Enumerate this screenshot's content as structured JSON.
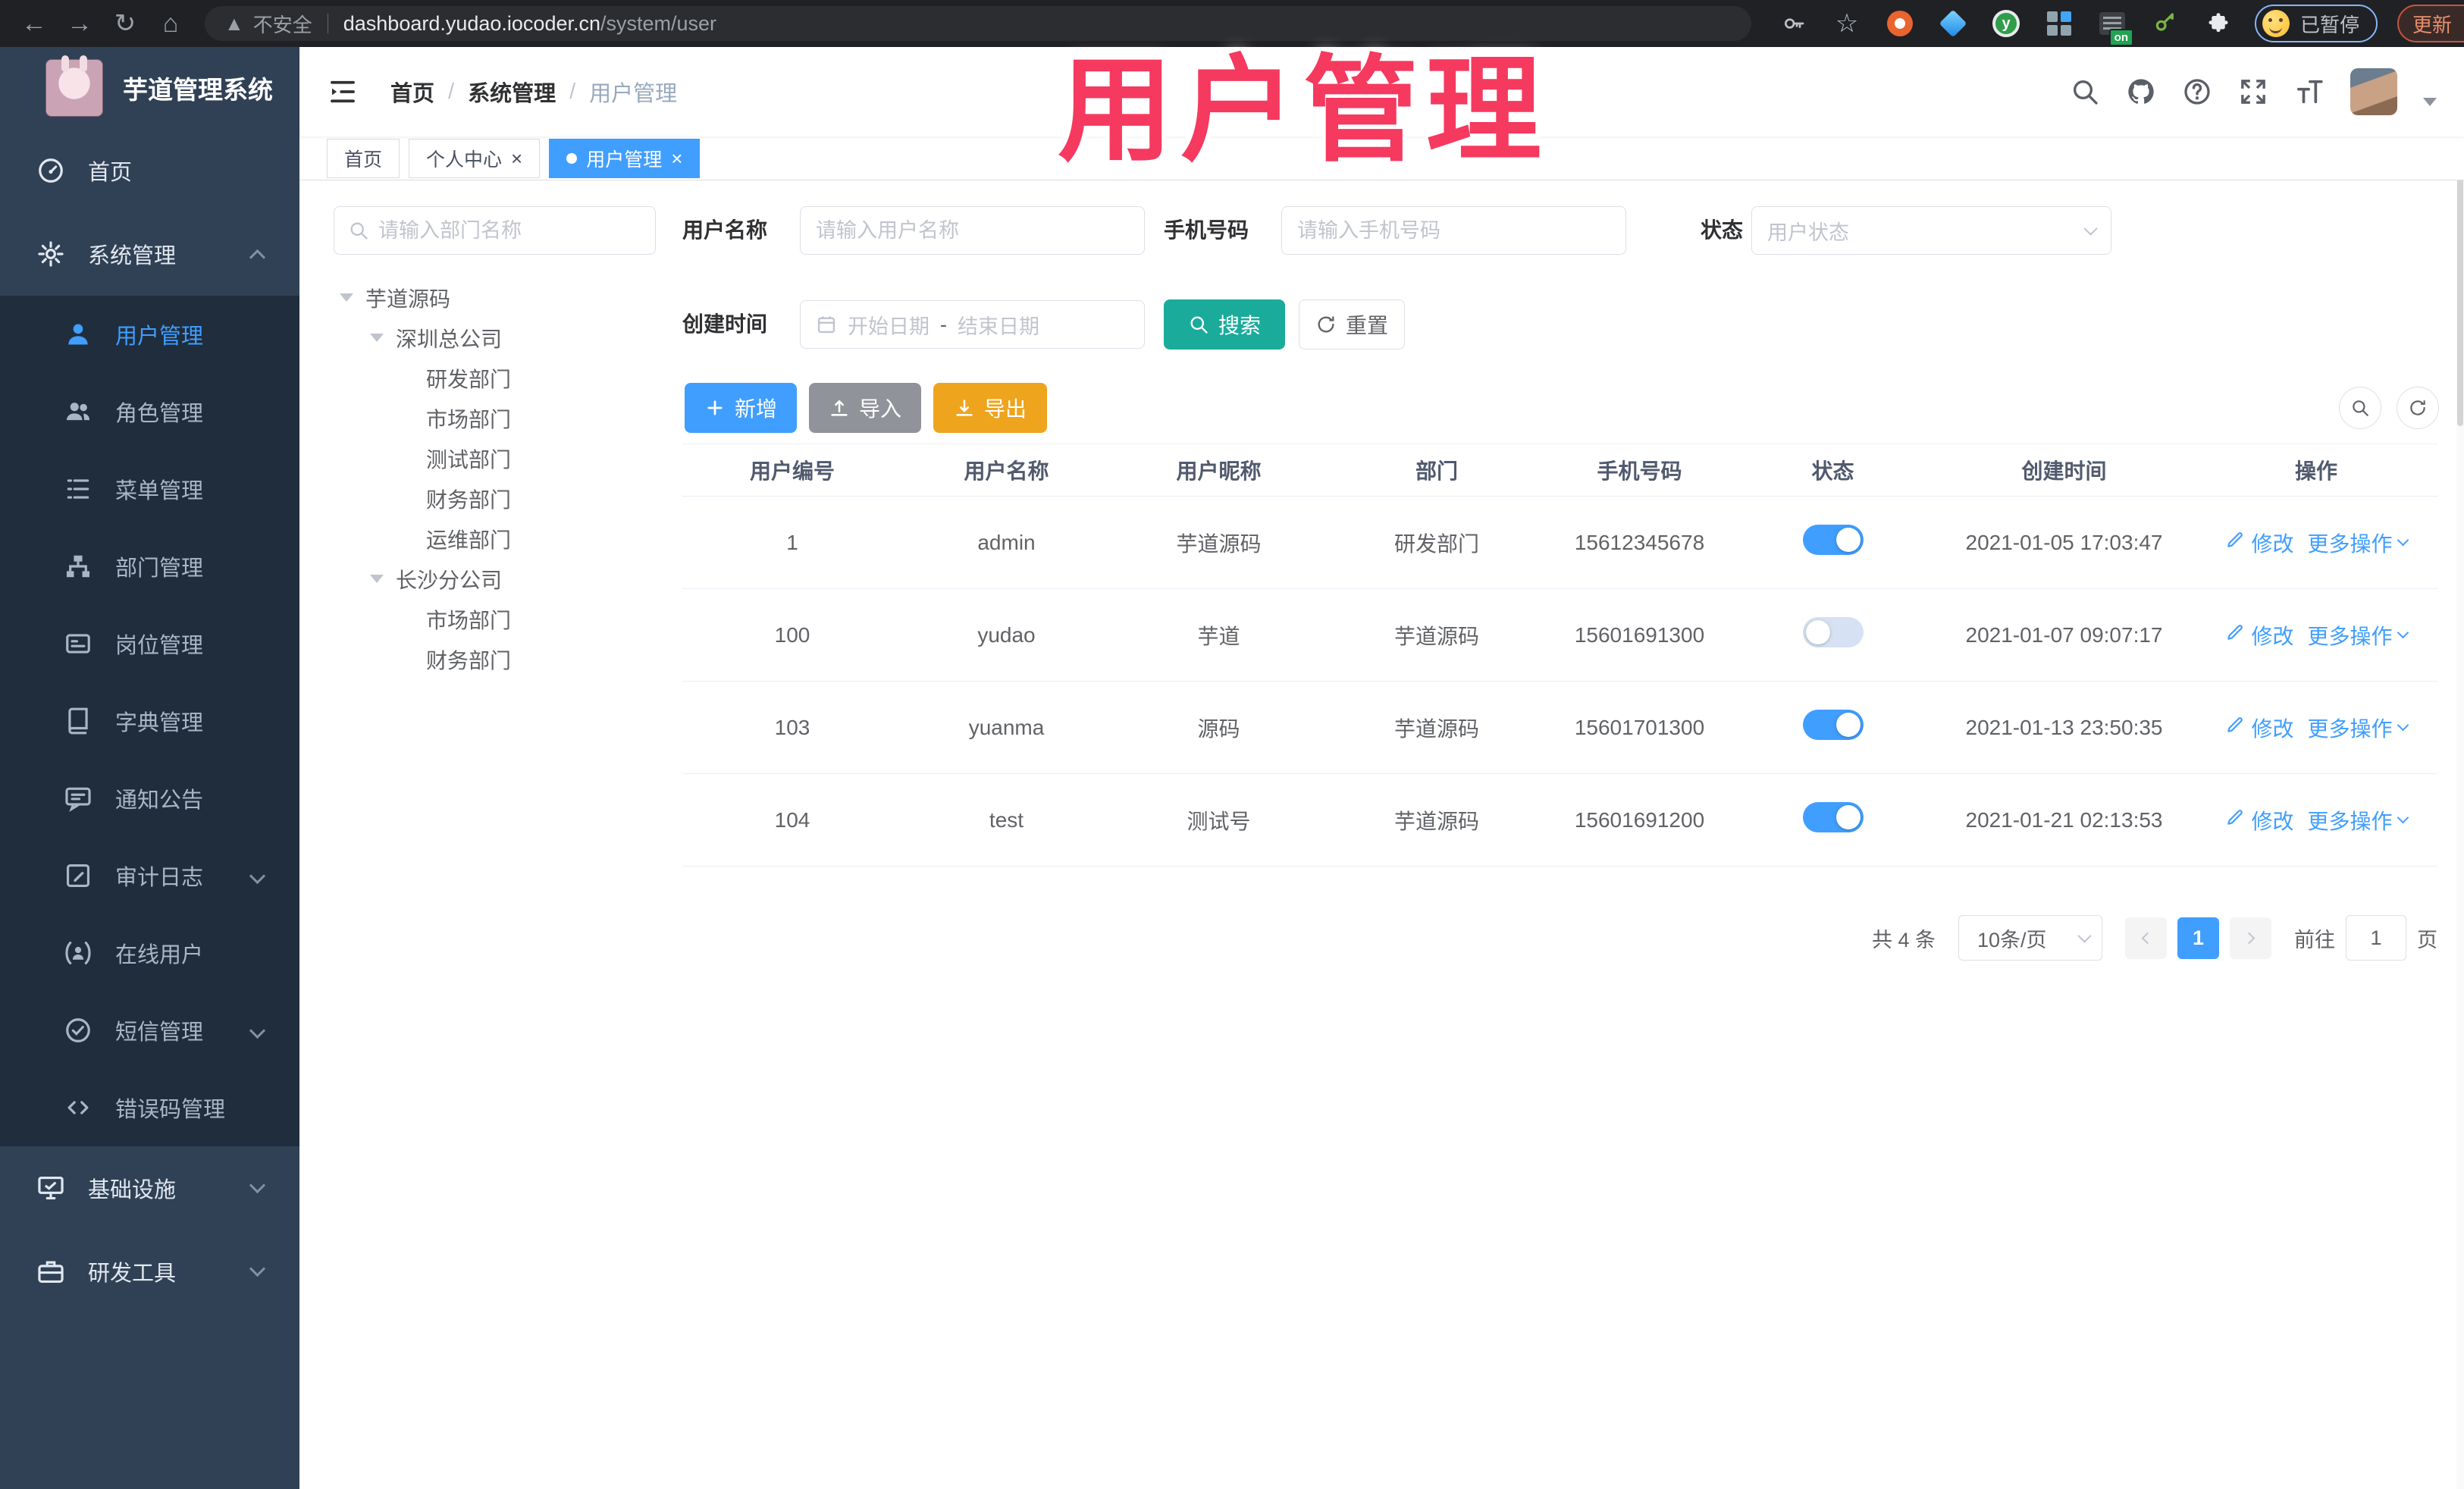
{
  "browser": {
    "security_label": "不安全",
    "url_host": "dashboard.yudao.iocoder.cn",
    "url_path": "/system/user",
    "profile_status": "已暂停",
    "update_label": "更新"
  },
  "icons": {
    "close": "×",
    "extension_on_badge": "on",
    "extension_y_logo": "y"
  },
  "watermark": {
    "text": "用户管理",
    "color": "#f5395f"
  },
  "sidebar": {
    "title": "芋道管理系统",
    "items": [
      {
        "key": "home",
        "icon": "gauge",
        "label": "首页",
        "type": "top"
      },
      {
        "key": "system",
        "icon": "gear",
        "label": "系统管理",
        "type": "top",
        "chevron": "up"
      },
      {
        "key": "user-mgmt",
        "icon": "user",
        "label": "用户管理",
        "type": "sub",
        "active": true
      },
      {
        "key": "role-mgmt",
        "icon": "users",
        "label": "角色管理",
        "type": "sub"
      },
      {
        "key": "menu-mgmt",
        "icon": "menu",
        "label": "菜单管理",
        "type": "sub"
      },
      {
        "key": "dept-mgmt",
        "icon": "dept",
        "label": "部门管理",
        "type": "sub"
      },
      {
        "key": "post-mgmt",
        "icon": "post",
        "label": "岗位管理",
        "type": "sub"
      },
      {
        "key": "dict-mgmt",
        "icon": "dict",
        "label": "字典管理",
        "type": "sub"
      },
      {
        "key": "notice",
        "icon": "notice",
        "label": "通知公告",
        "type": "sub"
      },
      {
        "key": "audit-log",
        "icon": "audit",
        "label": "审计日志",
        "type": "sub",
        "chevron": "down"
      },
      {
        "key": "online-users",
        "icon": "online",
        "label": "在线用户",
        "type": "sub"
      },
      {
        "key": "sms-mgmt",
        "icon": "sms",
        "label": "短信管理",
        "type": "sub",
        "chevron": "down"
      },
      {
        "key": "error-code",
        "icon": "errcode",
        "label": "错误码管理",
        "type": "sub"
      },
      {
        "key": "infra",
        "icon": "infra",
        "label": "基础设施",
        "type": "top",
        "chevron": "down"
      },
      {
        "key": "dev-tools",
        "icon": "tools",
        "label": "研发工具",
        "type": "top",
        "chevron": "down"
      }
    ]
  },
  "breadcrumb": {
    "separator": "/",
    "items": [
      "首页",
      "系统管理",
      "用户管理"
    ]
  },
  "tabs": [
    {
      "key": "home",
      "label": "首页"
    },
    {
      "key": "profile",
      "label": "个人中心",
      "closable": true
    },
    {
      "key": "user-mgmt",
      "label": "用户管理",
      "closable": true,
      "active": true
    }
  ],
  "dept_tree": {
    "search_placeholder": "请输入部门名称",
    "nodes": [
      {
        "label": "芋道源码",
        "indent": 0,
        "expandable": true
      },
      {
        "label": "深圳总公司",
        "indent": 1,
        "expandable": true
      },
      {
        "label": "研发部门",
        "indent": 2
      },
      {
        "label": "市场部门",
        "indent": 2
      },
      {
        "label": "测试部门",
        "indent": 2
      },
      {
        "label": "财务部门",
        "indent": 2
      },
      {
        "label": "运维部门",
        "indent": 2
      },
      {
        "label": "长沙分公司",
        "indent": 1,
        "expandable": true
      },
      {
        "label": "市场部门",
        "indent": 2
      },
      {
        "label": "财务部门",
        "indent": 2
      }
    ]
  },
  "filters": {
    "username_label": "用户名称",
    "username_placeholder": "请输入用户名称",
    "mobile_label": "手机号码",
    "mobile_placeholder": "请输入手机号码",
    "status_label": "状态",
    "status_placeholder": "用户状态",
    "create_time_label": "创建时间",
    "date_start_placeholder": "开始日期",
    "date_separator": "-",
    "date_end_placeholder": "结束日期",
    "search_label": "搜索",
    "reset_label": "重置"
  },
  "toolbar": {
    "add_label": "新增",
    "import_label": "导入",
    "export_label": "导出"
  },
  "table": {
    "columns": [
      "用户编号",
      "用户名称",
      "用户昵称",
      "部门",
      "手机号码",
      "状态",
      "创建时间",
      "操作"
    ],
    "row_actions": {
      "edit": "修改",
      "more": "更多操作"
    },
    "rows": [
      {
        "id": "1",
        "username": "admin",
        "nickname": "芋道源码",
        "dept": "研发部门",
        "mobile": "15612345678",
        "status": true,
        "created": "2021-01-05 17:03:47"
      },
      {
        "id": "100",
        "username": "yudao",
        "nickname": "芋道",
        "dept": "芋道源码",
        "mobile": "15601691300",
        "status": false,
        "created": "2021-01-07 09:07:17"
      },
      {
        "id": "103",
        "username": "yuanma",
        "nickname": "源码",
        "dept": "芋道源码",
        "mobile": "15601701300",
        "status": true,
        "created": "2021-01-13 23:50:35"
      },
      {
        "id": "104",
        "username": "test",
        "nickname": "测试号",
        "dept": "芋道源码",
        "mobile": "15601691200",
        "status": true,
        "created": "2021-01-21 02:13:53"
      }
    ]
  },
  "pagination": {
    "total_label": "共 4 条",
    "page_size": "10条/页",
    "current_page": "1",
    "goto_label": "前往",
    "goto_value": "1",
    "page_unit": "页"
  },
  "colors": {
    "accent": "#409eff",
    "teal": "#1aab9b",
    "warning": "#efa41d",
    "info": "#909399",
    "sidebar_bg": "#304156",
    "submenu_bg": "#1f2d3d"
  }
}
